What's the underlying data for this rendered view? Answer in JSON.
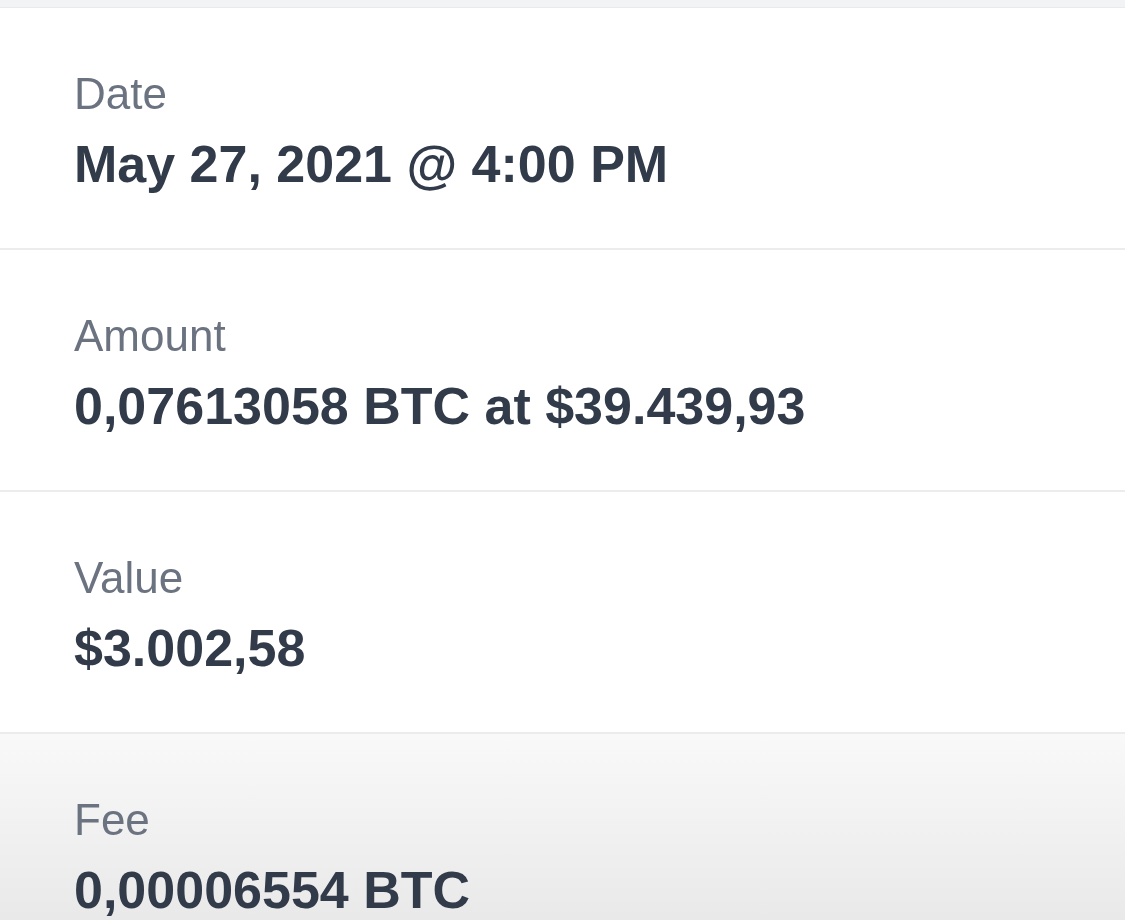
{
  "fields": [
    {
      "label": "Date",
      "value": "May 27, 2021 @ 4:00 PM"
    },
    {
      "label": "Amount",
      "value": "0,07613058 BTC at $39.439,93"
    },
    {
      "label": "Value",
      "value": "$3.002,58"
    },
    {
      "label": "Fee",
      "value": "0,00006554 BTC"
    }
  ]
}
